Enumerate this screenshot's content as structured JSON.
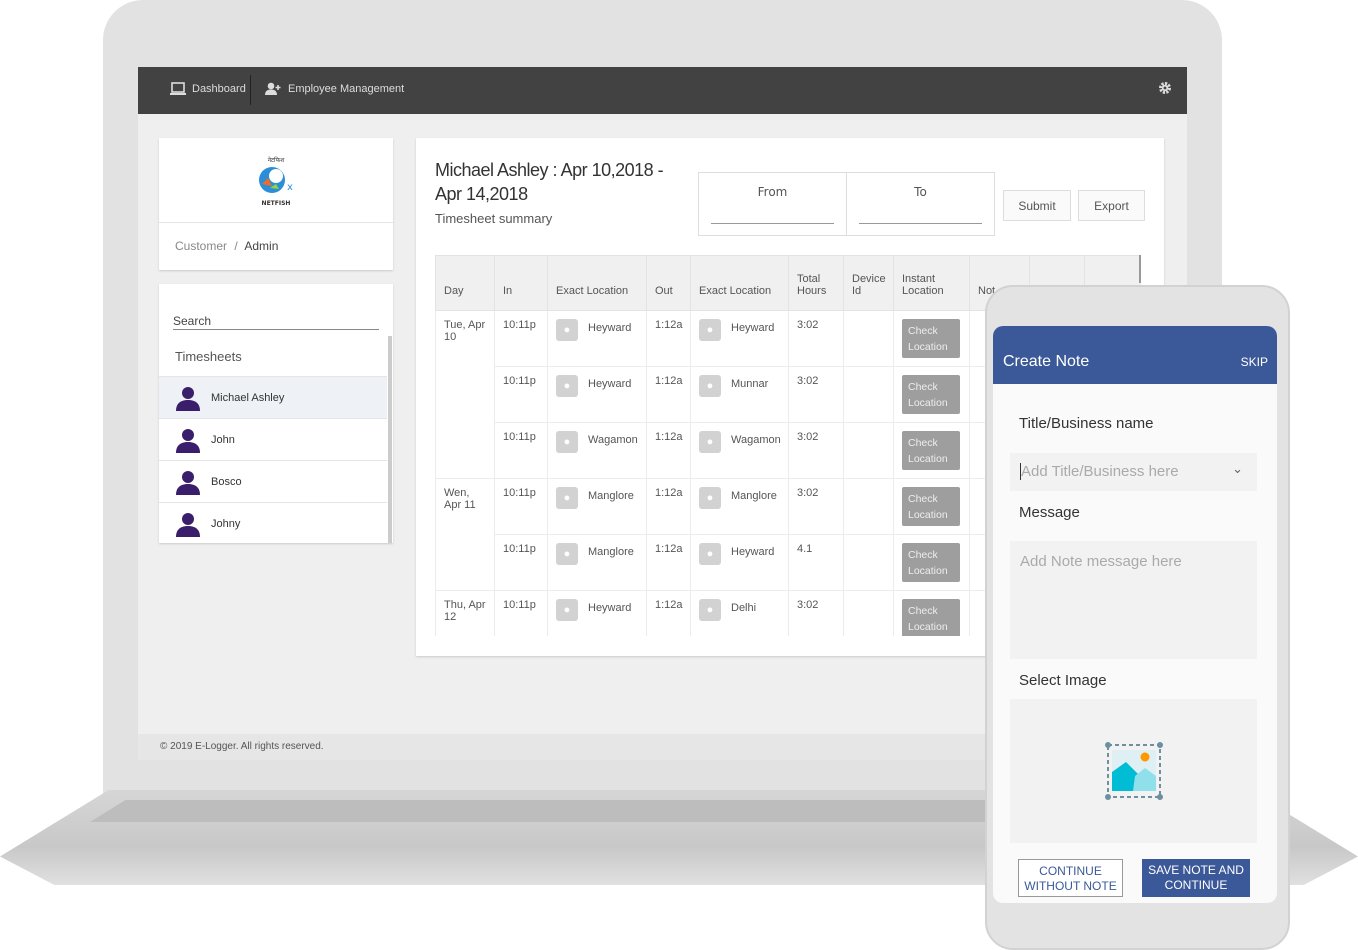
{
  "topbar": {
    "dashboard": "Dashboard",
    "employee_management": "Employee Management",
    "icons": [
      "monitor-icon",
      "user-plus-icon",
      "gear-icon"
    ]
  },
  "brand": {
    "logo_text": "NETFISH",
    "logo_script": "नेटफिश"
  },
  "breadcrumb": {
    "parent": "Customer",
    "separator": "/",
    "current": "Admin"
  },
  "sidebar": {
    "search_placeholder": "Search",
    "section": "Timesheets",
    "employees": [
      "Michael Ashley",
      "John",
      "Bosco",
      "Johny"
    ],
    "selected": "Michael Ashley"
  },
  "main": {
    "title": "Michael Ashley : Apr 10,2018 - Apr 14,2018",
    "subtitle": "Timesheet summary",
    "from_label": "From",
    "to_label": "To",
    "submit": "Submit",
    "export": "Export"
  },
  "table": {
    "headers": [
      "Day",
      "In",
      "Exact Location",
      "Out",
      "Exact Location",
      "Total Hours",
      "Device Id",
      "Instant Location",
      "Not"
    ],
    "button_label": "Check Location",
    "rows": [
      {
        "day": "Tue, Apr 10",
        "in": "10:11p",
        "in_loc": "Heyward",
        "out": "1:12a",
        "out_loc": "Heyward",
        "total": "3:02",
        "device": ""
      },
      {
        "day": "",
        "in": "10:11p",
        "in_loc": "Heyward",
        "out": "1:12a",
        "out_loc": "Munnar",
        "total": "3:02",
        "device": ""
      },
      {
        "day": "",
        "in": "10:11p",
        "in_loc": "Wagamon",
        "out": "1:12a",
        "out_loc": "Wagamon",
        "total": "3:02",
        "device": ""
      },
      {
        "day": "Wen, Apr 11",
        "in": "10:11p",
        "in_loc": "Manglore",
        "out": "1:12a",
        "out_loc": "Manglore",
        "total": "3:02",
        "device": ""
      },
      {
        "day": "",
        "in": "10:11p",
        "in_loc": "Manglore",
        "out": "1:12a",
        "out_loc": "Heyward",
        "total": "4.1",
        "device": ""
      },
      {
        "day": "Thu, Apr 12",
        "in": "10:11p",
        "in_loc": "Heyward",
        "out": "1:12a",
        "out_loc": "Delhi",
        "total": "3:02",
        "device": ""
      }
    ]
  },
  "footer": "© 2019 E-Logger. All rights reserved.",
  "note": {
    "title": "Create Note",
    "skip": "SKIP",
    "title_label": "Title/Business name",
    "title_placeholder": "Add Title/Business here",
    "message_label": "Message",
    "message_placeholder": "Add Note message here",
    "image_label": "Select Image",
    "continue_without": "CONTINUE WITHOUT NOTE",
    "save": "SAVE NOTE AND CONTINUE",
    "accent": "#3b5998"
  }
}
